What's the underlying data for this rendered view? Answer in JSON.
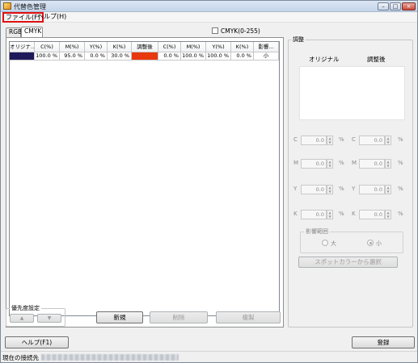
{
  "window": {
    "title": "代替色管理",
    "minimize": "–",
    "maximize": "□",
    "close": "×"
  },
  "menu": {
    "file": "ファイル(F)",
    "help": "ヘルプ(H)"
  },
  "tabs": {
    "rgb": "RGB",
    "cmyk": "CMYK"
  },
  "cmyk_checkbox": {
    "label": "CMYK(0-255)",
    "checked": false
  },
  "table": {
    "columns": [
      "オリジナ...",
      "C(%)",
      "M(%)",
      "Y(%)",
      "K(%)",
      "調整後",
      "C(%)",
      "M(%)",
      "Y(%)",
      "K(%)",
      "影響..."
    ],
    "rows": [
      {
        "orig_color": "#1e1a5a",
        "c": "100.0 %",
        "m": "95.0 %",
        "y": "0.0 %",
        "k": "30.0 %",
        "adj_color": "#e8390e",
        "c2": "0.0 %",
        "m2": "100.0 %",
        "y2": "100.0 %",
        "k2": "0.0 %",
        "influence": "小"
      }
    ]
  },
  "priority": {
    "label": "優先度設定",
    "up": "▲",
    "down": "▼"
  },
  "buttons": {
    "new": "新規",
    "delete": "削除",
    "copy": "複製",
    "help_f1": "ヘルプ(F1)",
    "register": "登録",
    "spot": "スポットカラーから選択"
  },
  "adjust": {
    "label": "調整",
    "original_label": "オリジナル",
    "adjusted_label": "調整後",
    "fields": [
      {
        "letter": "C",
        "orig": "0.0",
        "adj": "0.0",
        "unit": "%"
      },
      {
        "letter": "M",
        "orig": "0.0",
        "adj": "0.0",
        "unit": "%"
      },
      {
        "letter": "Y",
        "orig": "0.0",
        "adj": "0.0",
        "unit": "%"
      },
      {
        "letter": "K",
        "orig": "0.0",
        "adj": "0.0",
        "unit": "%"
      }
    ],
    "range": {
      "label": "影響範囲",
      "large": "大",
      "small": "小",
      "selected": "small"
    }
  },
  "status": {
    "label": "現在の接続先"
  }
}
